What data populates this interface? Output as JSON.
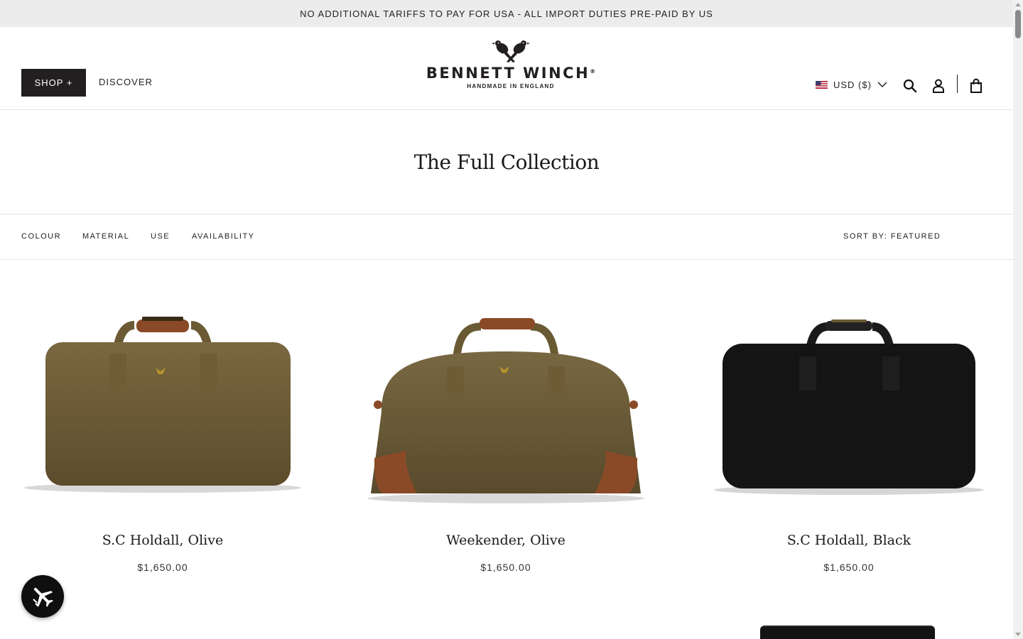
{
  "announcement": {
    "text": "NO ADDITIONAL TARIFFS TO PAY FOR USA - ALL IMPORT DUTIES PRE-PAID BY US"
  },
  "header": {
    "shop_label": "SHOP +",
    "discover_label": "DISCOVER",
    "logo": {
      "name": "BENNETT WINCH",
      "registered": "®",
      "tagline": "HANDMADE IN ENGLAND"
    },
    "currency": {
      "label": "USD ($)",
      "flag_icon": "us-flag-icon"
    },
    "icons": [
      "search-icon",
      "account-icon",
      "cart-icon"
    ]
  },
  "page": {
    "title": "The Full Collection"
  },
  "filters": {
    "items": [
      "COLOUR",
      "MATERIAL",
      "USE",
      "AVAILABILITY"
    ],
    "sort_label": "SORT BY: FEATURED"
  },
  "products": [
    {
      "name": "S.C Holdall, Olive",
      "price": "$1,650.00",
      "color": "#6b5a34"
    },
    {
      "name": "Weekender, Olive",
      "price": "$1,650.00",
      "color": "#6a5a33"
    },
    {
      "name": "S.C Holdall, Black",
      "price": "$1,650.00",
      "color": "#141414"
    }
  ],
  "floating_badge": {
    "icon": "airplane-icon"
  },
  "colors": {
    "accent": "#231f20",
    "announcement_bg": "#ececec",
    "leather": "#8a4a28"
  }
}
